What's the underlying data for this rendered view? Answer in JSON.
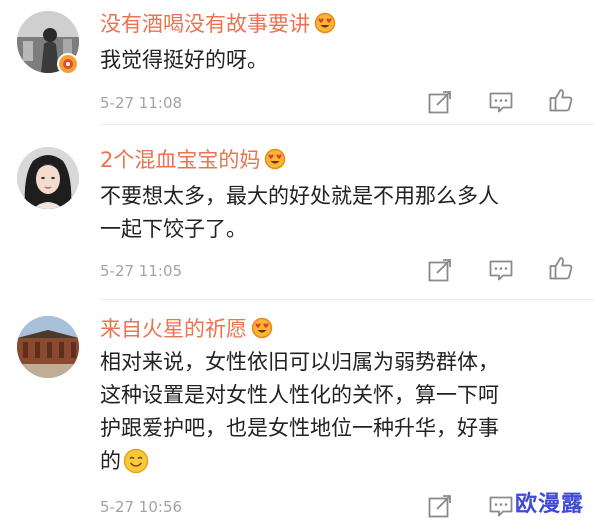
{
  "comments": [
    {
      "username": "没有酒喝没有故事要讲",
      "lines": [
        "我觉得挺好的呀。"
      ],
      "time": "5-27 11:08"
    },
    {
      "username": "2个混血宝宝的妈",
      "lines": [
        "不要想太多，最大的好处就是不用那么多人",
        "一起下饺子了。"
      ],
      "time": "5-27 11:05"
    },
    {
      "username": "来自火星的祈愿",
      "lines": [
        "相对来说，女性依旧可以归属为弱势群体，",
        "这种设置是对女性人性化的关怀，算一下呵",
        "护跟爱护吧，也是女性地位一种升华，好事",
        "的"
      ],
      "time": "5-27 10:56"
    }
  ],
  "icons": {
    "badge": "heart-eyes-badge-icon",
    "share": "share-icon",
    "reply": "comment-icon",
    "like": "thumbs-up-icon",
    "emoji": "smile-emoji-icon",
    "verified": "verified-badge-icon"
  },
  "colors": {
    "username": "#eb7350",
    "text": "#222222",
    "meta": "#a3a3a3",
    "watermark": "#3f4bd4"
  },
  "watermark": "欧漫露"
}
